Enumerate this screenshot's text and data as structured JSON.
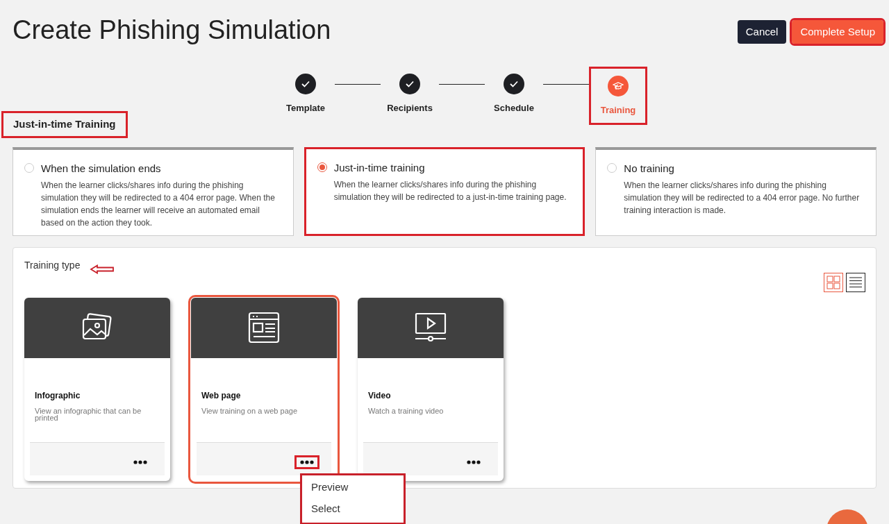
{
  "title": "Create Phishing Simulation",
  "actions": [
    {
      "label": "Cancel",
      "kind": "secondary",
      "highlighted": false
    },
    {
      "label": "Complete Setup",
      "kind": "primary",
      "highlighted": true
    }
  ],
  "steps": [
    {
      "label": "Template",
      "done": true,
      "active": false,
      "highlighted": false
    },
    {
      "label": "Recipients",
      "done": true,
      "active": false,
      "highlighted": false
    },
    {
      "label": "Schedule",
      "done": true,
      "active": false,
      "highlighted": false
    },
    {
      "label": "Training",
      "done": false,
      "active": true,
      "highlighted": true
    }
  ],
  "section": {
    "title": "Just-in-time Training",
    "highlighted": true
  },
  "options": [
    {
      "title": "When the simulation ends",
      "description": "When the learner clicks/shares info during the phishing simulation they will be redirected to a 404 error page. When the simulation ends the learner will receive an automated email based on the action they took.",
      "selected": false
    },
    {
      "title": "Just-in-time training",
      "description": "When the learner clicks/shares info during the phishing simulation they will be redirected to a just-in-time training page.",
      "selected": true
    },
    {
      "title": "No training",
      "description": "When the learner clicks/shares info during the phishing simulation they will be redirected to a 404 error page. No further training interaction is made.",
      "selected": false
    }
  ],
  "training_type": {
    "label": "Training type",
    "view_toggle": [
      {
        "kind": "grid",
        "selected": true
      },
      {
        "kind": "list",
        "selected": false
      }
    ],
    "cards": [
      {
        "kind": "image",
        "title": "Infographic",
        "description": "View an infographic that can be printed",
        "selected": false,
        "menu_highlighted": false
      },
      {
        "kind": "webpage",
        "title": "Web page",
        "description": "View training on a web page",
        "selected": true,
        "menu_highlighted": true,
        "menu": [
          "Preview",
          "Select"
        ]
      },
      {
        "kind": "video",
        "title": "Video",
        "description": "Watch a training video",
        "selected": false,
        "menu_highlighted": false
      }
    ]
  }
}
